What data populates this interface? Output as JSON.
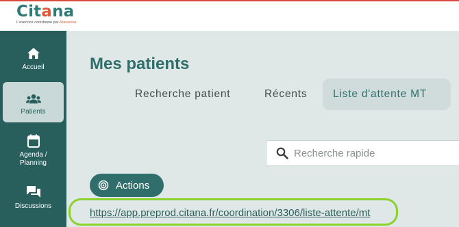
{
  "brand": {
    "logo_prefix": "Cit",
    "logo_accent": "a",
    "logo_suffix": "na",
    "tagline_prefix": "L'exercice coordonné par ",
    "tagline_brand": "Aravenine",
    "accent_color": "#e0593b",
    "primary_color": "#2f7b77"
  },
  "sidebar": {
    "items": [
      {
        "label": "Accueil",
        "icon": "home-icon",
        "active": false
      },
      {
        "label": "Patients",
        "icon": "users-icon",
        "active": true
      },
      {
        "label": "Agenda /\nPlanning",
        "icon": "calendar-icon",
        "active": false
      },
      {
        "label": "Discussions",
        "icon": "chat-icon",
        "active": false
      }
    ]
  },
  "main": {
    "title": "Mes patients",
    "tabs": [
      {
        "label": "Recherche patient",
        "active": false
      },
      {
        "label": "Récents",
        "active": false
      },
      {
        "label": "Liste d'attente MT",
        "active": true
      }
    ],
    "search": {
      "placeholder": "Recherche rapide",
      "icon": "search-icon"
    },
    "actions_button": {
      "label": "Actions",
      "icon": "target-icon"
    },
    "url_link": "https://app.preprod.citana.fr/coordination/3306/liste-attente/mt",
    "highlight_color": "#8bd22a"
  }
}
